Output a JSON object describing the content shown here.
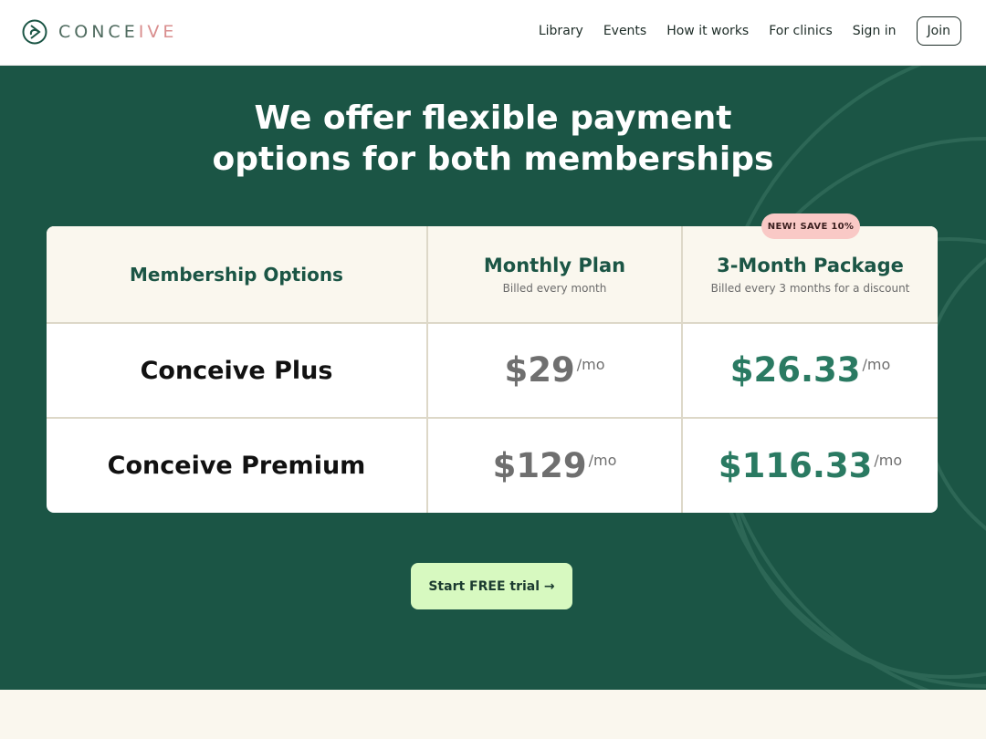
{
  "brand": {
    "name_part1": "CONCE",
    "name_part2": "IVE"
  },
  "nav": {
    "items": [
      {
        "label": "Library"
      },
      {
        "label": "Events"
      },
      {
        "label": "How it works"
      },
      {
        "label": "For clinics"
      },
      {
        "label": "Sign in"
      }
    ],
    "join_label": "Join"
  },
  "hero": {
    "title_line1": "We offer flexible payment",
    "title_line2": "options for both memberships"
  },
  "table": {
    "header": {
      "options_label": "Membership Options",
      "monthly": {
        "title": "Monthly Plan",
        "subtitle": "Billed every month"
      },
      "quarterly": {
        "title": "3-Month Package",
        "subtitle": "Billed every 3 months for a discount"
      },
      "badge": "NEW! SAVE 10%"
    },
    "rows": [
      {
        "name": "Conceive Plus",
        "monthly_price": "$29",
        "quarterly_price": "$26.33"
      },
      {
        "name": "Conceive Premium",
        "monthly_price": "$129",
        "quarterly_price": "$116.33"
      }
    ],
    "per_unit": "/mo"
  },
  "cta": {
    "label": "Start FREE trial →"
  },
  "colors": {
    "hero_bg": "#1b5545",
    "accent_green": "#2a7a62",
    "cta_bg": "#d7f9c0",
    "badge_bg": "#f9c9c6",
    "cream": "#faf7ee"
  }
}
